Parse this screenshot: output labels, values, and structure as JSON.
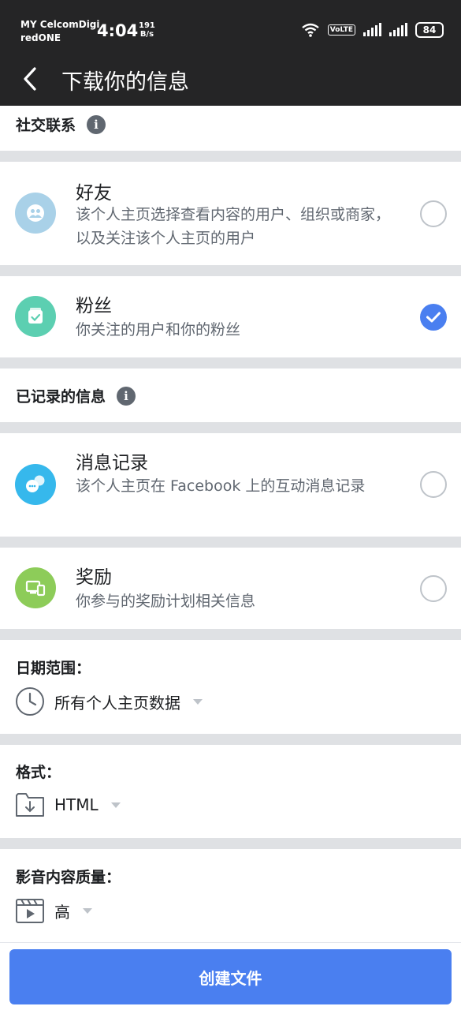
{
  "status_bar": {
    "carrier_line1": "MY CelcomDigi",
    "carrier_line2": "redONE",
    "time": "4:04",
    "net_speed_value": "191",
    "net_speed_unit": "B/s",
    "volte": "VoLTE",
    "battery": "84"
  },
  "header": {
    "title": "下载你的信息"
  },
  "social": {
    "section_title": "社交联系",
    "friends": {
      "title": "好友",
      "description": "该个人主页选择查看内容的用户、组织或商家，以及关注该个人主页的用户",
      "checked": false,
      "icon_color": "#a9d1e8"
    },
    "followers": {
      "title": "粉丝",
      "description": "你关注的用户和你的粉丝",
      "checked": true,
      "icon_color": "#5ccfb1"
    }
  },
  "logged": {
    "section_title": "已记录的信息",
    "messages": {
      "title": "消息记录",
      "description": "该个人主页在 Facebook 上的互动消息记录",
      "checked": false,
      "icon_color": "#36b8ec"
    },
    "rewards": {
      "title": "奖励",
      "description": "你参与的奖励计划相关信息",
      "checked": false,
      "icon_color": "#8dcc59"
    }
  },
  "date_range": {
    "label": "日期范围：",
    "value": "所有个人主页数据",
    "icon": "clock-icon"
  },
  "format": {
    "label": "格式：",
    "value": "HTML",
    "icon": "folder-download-icon"
  },
  "media_quality": {
    "label": "影音内容质量：",
    "value": "高",
    "icon": "video-clapper-icon"
  },
  "footer": {
    "create_button": "创建文件"
  },
  "colors": {
    "accent": "#4a7ff0",
    "header_bg": "#252526",
    "divider": "#dfe1e4"
  }
}
